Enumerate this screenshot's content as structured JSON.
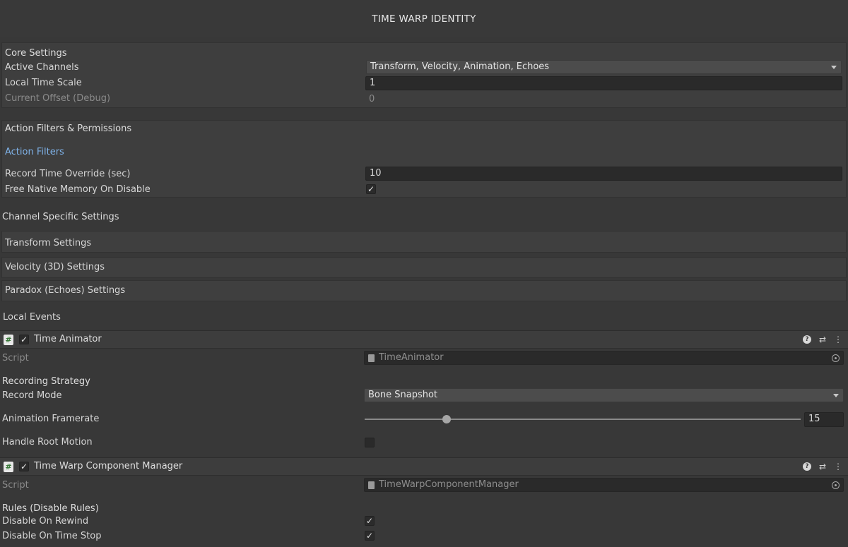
{
  "window_title": "TIME WARP IDENTITY",
  "core": {
    "header": "Core Settings",
    "active_channels_label": "Active Channels",
    "active_channels_value": "Transform, Velocity, Animation, Echoes",
    "local_time_scale_label": "Local Time Scale",
    "local_time_scale_value": "1",
    "current_offset_label": "Current Offset (Debug)",
    "current_offset_value": "0"
  },
  "filters": {
    "header": "Action Filters & Permissions",
    "action_filters_link": "Action Filters",
    "record_override_label": "Record Time Override (sec)",
    "record_override_value": "10",
    "free_memory_label": "Free Native Memory On Disable",
    "free_memory_checked": true
  },
  "channel_specific": {
    "header": "Channel Specific Settings",
    "foldouts": [
      "Transform Settings",
      "Velocity (3D) Settings",
      "Paradox (Echoes) Settings"
    ]
  },
  "local_events_label": "Local Events",
  "time_animator": {
    "title": "Time Animator",
    "enabled": true,
    "script_label": "Script",
    "script_value": "TimeAnimator",
    "recording_strategy_header": "Recording Strategy",
    "record_mode_label": "Record Mode",
    "record_mode_value": "Bone Snapshot",
    "framerate_label": "Animation Framerate",
    "framerate_value": "15",
    "framerate_slider_fraction": 0.19,
    "root_motion_label": "Handle Root Motion",
    "root_motion_checked": false
  },
  "component_manager": {
    "title": "Time Warp Component Manager",
    "enabled": true,
    "script_label": "Script",
    "script_value": "TimeWarpComponentManager",
    "rules_header": "Rules (Disable Rules)",
    "disable_on_rewind_label": "Disable On Rewind",
    "disable_on_rewind_checked": true,
    "disable_on_time_stop_label": "Disable On Time Stop",
    "disable_on_time_stop_checked": true
  },
  "icons": {
    "checkmark": "✓",
    "script": "#",
    "help": "?",
    "presets": "⇄",
    "more": "⋮"
  }
}
